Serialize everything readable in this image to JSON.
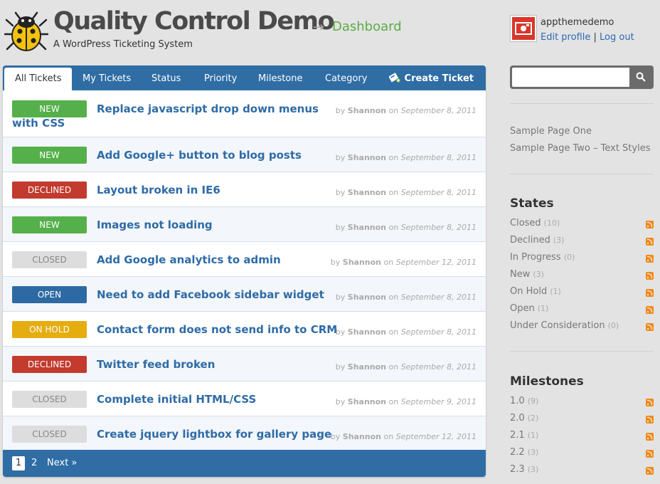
{
  "header": {
    "title": "Quality Control Demo",
    "arrow": "→",
    "section": "Dashboard",
    "tagline": "A WordPress Ticketing System"
  },
  "user": {
    "name": "appthemedemo",
    "edit_profile": "Edit profile",
    "separator": "|",
    "logout": "Log out"
  },
  "tabs": [
    "All Tickets",
    "My Tickets",
    "Status",
    "Priority",
    "Milestone",
    "Category"
  ],
  "create_ticket": "Create Ticket",
  "meta_by": "by",
  "meta_on": "on",
  "tickets": [
    {
      "status": "NEW",
      "title": "Replace javascript drop down menus with CSS",
      "author": "Shannon",
      "date": "September 8, 2011"
    },
    {
      "status": "NEW",
      "title": "Add Google+ button to blog posts",
      "author": "Shannon",
      "date": "September 8, 2011"
    },
    {
      "status": "DECLINED",
      "title": "Layout broken in IE6",
      "author": "Shannon",
      "date": "September 8, 2011"
    },
    {
      "status": "NEW",
      "title": "Images not loading",
      "author": "Shannon",
      "date": "September 8, 2011"
    },
    {
      "status": "CLOSED",
      "title": "Add Google analytics to admin",
      "author": "Shannon",
      "date": "September 12, 2011"
    },
    {
      "status": "OPEN",
      "title": "Need to add Facebook sidebar widget",
      "author": "Shannon",
      "date": "September 8, 2011"
    },
    {
      "status": "ON HOLD",
      "title": "Contact form does not send info to CRM",
      "author": "Shannon",
      "date": "September 8, 2011"
    },
    {
      "status": "DECLINED",
      "title": "Twitter feed broken",
      "author": "Shannon",
      "date": "September 8, 2011"
    },
    {
      "status": "CLOSED",
      "title": "Complete initial HTML/CSS",
      "author": "Shannon",
      "date": "September 9, 2011"
    },
    {
      "status": "CLOSED",
      "title": "Create jquery lightbox for gallery page",
      "author": "Shannon",
      "date": "September 12, 2011"
    }
  ],
  "pagination": {
    "current": "1",
    "page2": "2",
    "next": "Next »"
  },
  "colors": {
    "new": "#55b04b",
    "declined": "#c23b2e",
    "closed": "#dddddd",
    "open": "#2d6aa3",
    "on_hold": "#e5ad10",
    "accent": "#2f6da4"
  },
  "sidebar": {
    "search_placeholder": "",
    "search_icon": "search-icon",
    "pages": [
      "Sample Page One",
      "Sample Page Two – Text Styles"
    ],
    "states_heading": "States",
    "states": [
      {
        "label": "Closed",
        "count": "(10)"
      },
      {
        "label": "Declined",
        "count": "(3)"
      },
      {
        "label": "In Progress",
        "count": "(0)"
      },
      {
        "label": "New",
        "count": "(3)"
      },
      {
        "label": "On Hold",
        "count": "(1)"
      },
      {
        "label": "Open",
        "count": "(1)"
      },
      {
        "label": "Under Consideration",
        "count": "(0)"
      }
    ],
    "milestones_heading": "Milestones",
    "milestones": [
      {
        "label": "1.0",
        "count": "(9)"
      },
      {
        "label": "2.0",
        "count": "(2)"
      },
      {
        "label": "2.1",
        "count": "(1)"
      },
      {
        "label": "2.2",
        "count": "(3)"
      },
      {
        "label": "2.3",
        "count": "(3)"
      }
    ]
  }
}
